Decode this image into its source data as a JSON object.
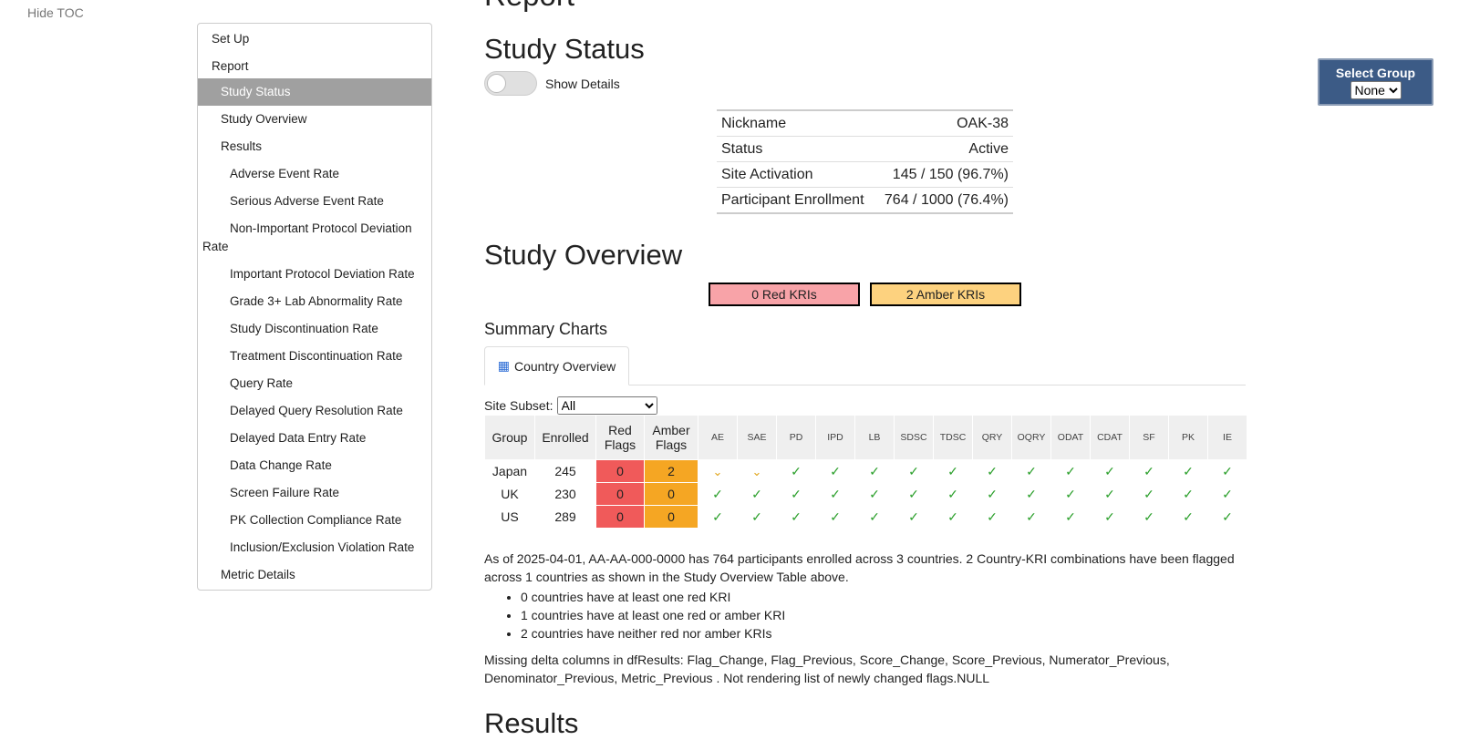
{
  "toc_toggle": "Hide TOC",
  "toc": {
    "items": [
      {
        "label": "Set Up"
      },
      {
        "label": "Report"
      },
      {
        "label": "Study Status"
      },
      {
        "label": "Study Overview"
      },
      {
        "label": "Results"
      },
      {
        "label": "Adverse Event Rate"
      },
      {
        "label": "Serious Adverse Event Rate"
      },
      {
        "label": "Non-Important Protocol Deviation Rate"
      },
      {
        "label": "Important Protocol Deviation Rate"
      },
      {
        "label": "Grade 3+ Lab Abnormality Rate"
      },
      {
        "label": "Study Discontinuation Rate"
      },
      {
        "label": "Treatment Discontinuation Rate"
      },
      {
        "label": "Query Rate"
      },
      {
        "label": "Delayed Query Resolution Rate"
      },
      {
        "label": "Delayed Data Entry Rate"
      },
      {
        "label": "Data Change Rate"
      },
      {
        "label": "Screen Failure Rate"
      },
      {
        "label": "PK Collection Compliance Rate"
      },
      {
        "label": "Inclusion/Exclusion Violation Rate"
      },
      {
        "label": "Metric Details"
      }
    ]
  },
  "headings": {
    "report": "Report",
    "study_status": "Study Status",
    "study_overview": "Study Overview",
    "results": "Results"
  },
  "toggle": {
    "label": "Show Details"
  },
  "status_table": {
    "rows": [
      {
        "label": "Nickname",
        "value": "OAK-38"
      },
      {
        "label": "Status",
        "value": "Active"
      },
      {
        "label": "Site Activation",
        "value": "145 / 150 (96.7%)"
      },
      {
        "label": "Participant Enrollment",
        "value": "764 / 1000 (76.4%)"
      }
    ]
  },
  "kri_counts": {
    "red": "0 Red KRIs",
    "amber": "2 Amber KRIs",
    "red_color": "#f8a3a8",
    "amber_color": "#fdd27f"
  },
  "summary": {
    "title": "Summary Charts",
    "tab_icon": "table-icon",
    "tab_label": "Country Overview",
    "subset_label": "Site Subset:",
    "subset_value": "All"
  },
  "overview_table": {
    "headers": {
      "group": "Group",
      "enrolled": "Enrolled",
      "red": "Red Flags",
      "amber": "Amber Flags",
      "kris": [
        "AE",
        "SAE",
        "PD",
        "IPD",
        "LB",
        "SDSC",
        "TDSC",
        "QRY",
        "OQRY",
        "ODAT",
        "CDAT",
        "SF",
        "PK",
        "IE"
      ]
    },
    "rows": [
      {
        "group": "Japan",
        "enrolled": "245",
        "red": "0",
        "amber": "2",
        "flags": [
          "amber",
          "amber",
          "green",
          "green",
          "green",
          "green",
          "green",
          "green",
          "green",
          "green",
          "green",
          "green",
          "green",
          "green"
        ]
      },
      {
        "group": "UK",
        "enrolled": "230",
        "red": "0",
        "amber": "0",
        "flags": [
          "green",
          "green",
          "green",
          "green",
          "green",
          "green",
          "green",
          "green",
          "green",
          "green",
          "green",
          "green",
          "green",
          "green"
        ]
      },
      {
        "group": "US",
        "enrolled": "289",
        "red": "0",
        "amber": "0",
        "flags": [
          "green",
          "green",
          "green",
          "green",
          "green",
          "green",
          "green",
          "green",
          "green",
          "green",
          "green",
          "green",
          "green",
          "green"
        ]
      }
    ],
    "colors": {
      "red": "#f05a5a",
      "amber": "#f5a623",
      "check_green": "#2ca02c",
      "check_amber": "#e0a418"
    }
  },
  "narrative": {
    "summary": "As of 2025-04-01, AA-AA-000-0000 has 764 participants enrolled across 3 countries. 2 Country-KRI combinations have been flagged across 1 countries as shown in the Study Overview Table above.",
    "bullets": [
      "0 countries have at least one red KRI",
      "1 countries have at least one red or amber KRI",
      "2 countries have neither red nor amber KRIs"
    ],
    "missing": "Missing delta columns in dfResults: Flag_Change, Flag_Previous, Score_Change, Score_Previous, Numerator_Previous, Denominator_Previous, Metric_Previous . Not rendering list of newly changed flags.NULL"
  },
  "select_group": {
    "label": "Select Group",
    "value": "None",
    "bg_color": "#3c5b86"
  }
}
